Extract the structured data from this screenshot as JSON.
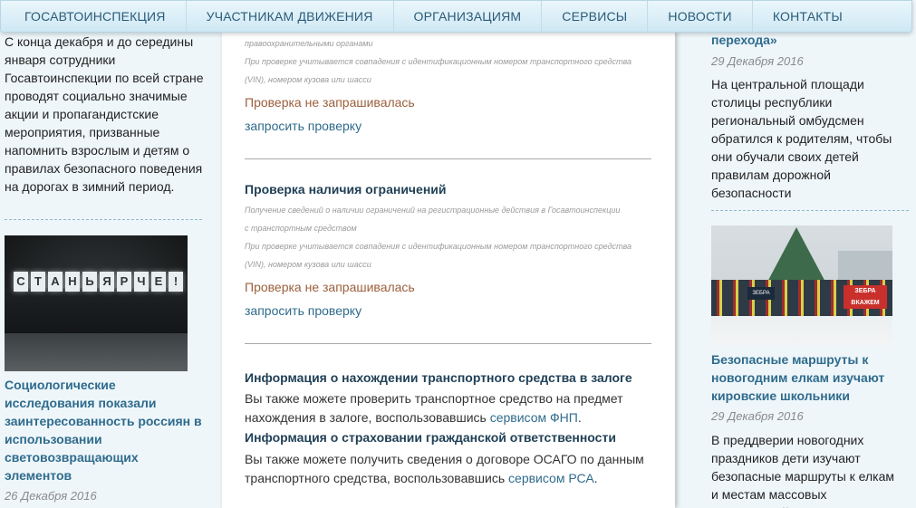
{
  "nav": {
    "items": [
      "ГОСАВТОИНСПЕКЦИЯ",
      "УЧАСТНИКАМ ДВИЖЕНИЯ",
      "ОРГАНИЗАЦИЯМ",
      "СЕРВИСЫ",
      "НОВОСТИ",
      "КОНТАКТЫ"
    ]
  },
  "left": {
    "paragraph": "С конца декабря и до середины января сотрудники Госавтоинспекции по всей стране проводят социально значимые акции и пропагандистские мероприятия, призванные напомнить взрослым и детям о правилах безопасного поведения на дорогах в зимний период.",
    "photo_sign_letters": [
      "С",
      "Т",
      "А",
      "Н",
      "Ь",
      "Я",
      "Р",
      "Ч",
      "Е",
      "!"
    ],
    "title": "Социологические исследования показали заинтересованность россиян в использовании световозвращающих элементов",
    "date": "26 Декабря 2016"
  },
  "center": {
    "top_note_partial": "правоохранительными органами",
    "top_note_vin": "При проверке учитывается совпадения с идентификационным номером транспортного средства (VIN), номером кузова или шасси",
    "check1_status": "Проверка не запрашивалась",
    "check1_link": "запросить проверку",
    "restrictions": {
      "title": "Проверка наличия ограничений",
      "note": "Получение сведений о наличии ограничений на регистрационные действия в Госавтоинспекции с транспортным средством",
      "note_vin": "При проверке учитывается совпадения с идентификационным номером транспортного средства (VIN), номером кузова или шасси",
      "status": "Проверка не запрашивалась",
      "link": "запросить проверку"
    },
    "pledge": {
      "title": "Информация о нахождении транспортного средства в залоге",
      "text": "Вы также можете проверить транспортное средство на предмет нахождения в залоге, воспользовавшись",
      "link": "сервисом ФНП",
      "after": "."
    },
    "insurance": {
      "title": "Информация о страховании гражданской ответственности",
      "text": "Вы также можете получить сведения о договоре ОСАГО по данным транспортного средства, воспользовавшись",
      "link": "сервисом РСА",
      "after": "."
    }
  },
  "right": {
    "title_tail": "перехода»",
    "date1": "29 Декабря 2016",
    "text1": "На центральной площади столицы республики региональный омбудсмен обратился к родителям, чтобы они обучали своих детей правилам дорожной безопасности",
    "photo_banner": "ЗЕБРА ВКАЖЕМ",
    "photo_banner2": "ЗЕБРА",
    "title2": "Безопасные маршруты к новогодним елкам изучают кировские школьники",
    "date2": "29 Декабря 2016",
    "text2": "В преддверии новогодних праздников дети изучают безопасные маршруты к елкам и местам массовых мероприятий,"
  },
  "colors": {
    "link": "#2f6b8c",
    "status": "#9b5f3c",
    "nav_text": "#2a5b78",
    "page_bg": "#eef6fa"
  }
}
